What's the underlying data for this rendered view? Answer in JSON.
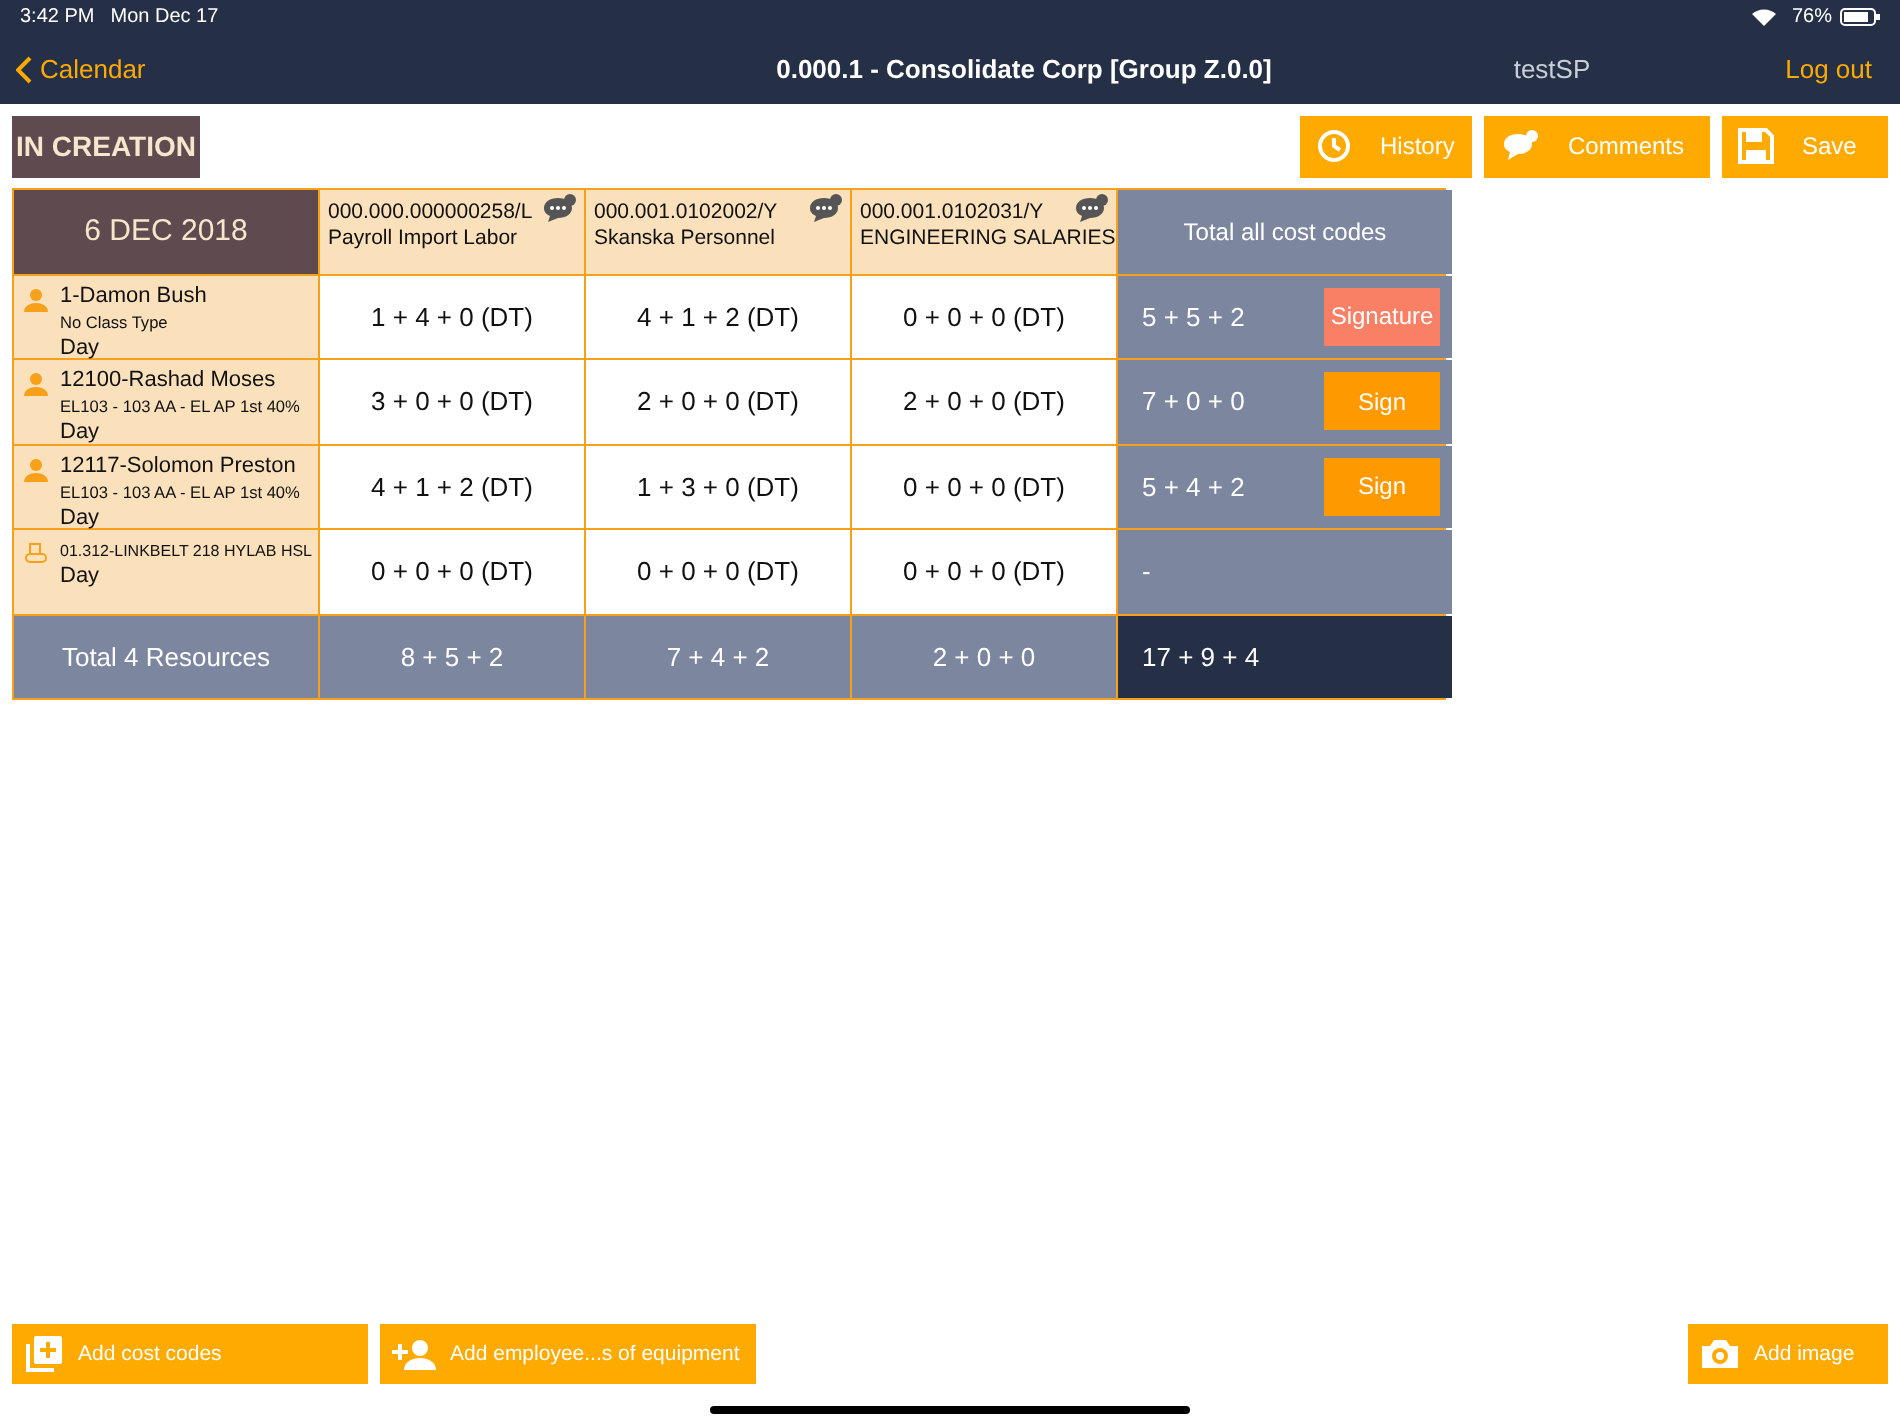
{
  "status_bar": {
    "time": "3:42 PM",
    "date": "Mon Dec 17",
    "battery": "76%"
  },
  "nav": {
    "back": "Calendar",
    "title": "0.000.1 - Consolidate Corp [Group Z.0.0]",
    "user": "testSP",
    "logout": "Log out"
  },
  "status": "IN CREATION",
  "toolbar": [
    {
      "label": "History",
      "kind": "history"
    },
    {
      "label": "Comments",
      "kind": "comments"
    },
    {
      "label": "Save",
      "kind": "save"
    }
  ],
  "table": {
    "date": "6 DEC 2018",
    "columns": [
      {
        "code": "000.000.000000258/L",
        "name": "Payroll Import Labor"
      },
      {
        "code": "000.001.0102002/Y",
        "name": "Skanska Personnel"
      },
      {
        "code": "000.001.0102031/Y",
        "name": "ENGINEERING SALARIES"
      }
    ],
    "total_header": "Total all cost codes",
    "rows": [
      {
        "kind": "person",
        "name": "1-Damon Bush",
        "class": "No Class Type",
        "shift": "Day",
        "cells": [
          "1 + 4 + 0 (DT)",
          "4 + 1 + 2 (DT)",
          "0 + 0 + 0 (DT)"
        ],
        "total": "5 + 5 + 2",
        "action": {
          "label": "Signature",
          "kind": "signature"
        }
      },
      {
        "kind": "person",
        "name": "12100-Rashad Moses",
        "class": "EL103 - 103 AA - EL AP 1st 40%",
        "shift": "Day",
        "cells": [
          "3 + 0 + 0 (DT)",
          "2 + 0 + 0 (DT)",
          "2 + 0 + 0 (DT)"
        ],
        "total": "7 + 0 + 0",
        "action": {
          "label": "Sign",
          "kind": "sign"
        }
      },
      {
        "kind": "person",
        "name": "12117-Solomon Preston",
        "class": "EL103 - 103 AA - EL AP 1st 40%",
        "shift": "Day",
        "cells": [
          "4 + 1 + 2 (DT)",
          "1 + 3 + 0 (DT)",
          "0 + 0 + 0 (DT)"
        ],
        "total": "5 + 4 + 2",
        "action": {
          "label": "Sign",
          "kind": "sign"
        }
      },
      {
        "kind": "equipment",
        "name": "01.312-LINKBELT 218  HYLAB HSL",
        "shift": "Day",
        "cells": [
          "0 + 0 + 0 (DT)",
          "0 + 0 + 0 (DT)",
          "0 + 0 + 0 (DT)"
        ],
        "total": "-"
      }
    ],
    "footer": {
      "label": "Total 4 Resources",
      "cells": [
        "8 + 5 + 2",
        "7 + 4 + 2",
        "2 + 0 + 0"
      ],
      "total": "17 + 9 + 4"
    }
  },
  "bottom_buttons": [
    {
      "label": "Add cost codes",
      "kind": "add-cost"
    },
    {
      "label": "Add employee...s of equipment",
      "kind": "add-employee"
    },
    {
      "label": "Add image",
      "kind": "add-image"
    }
  ]
}
